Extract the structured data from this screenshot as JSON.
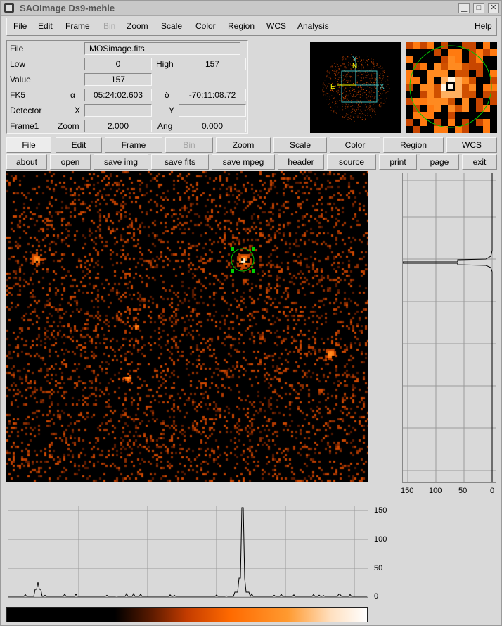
{
  "window": {
    "title": "SAOImage Ds9-mehle",
    "min_glyph": "▁",
    "max_glyph": "□",
    "close_glyph": "✕"
  },
  "menubar": {
    "items": [
      "File",
      "Edit",
      "Frame",
      "Bin",
      "Zoom",
      "Scale",
      "Color",
      "Region",
      "WCS",
      "Analysis"
    ],
    "help": "Help"
  },
  "info": {
    "file_label": "File",
    "file_value": "MOSimage.fits",
    "low_label": "Low",
    "low_value": "0",
    "high_label": "High",
    "high_value": "157",
    "value_label": "Value",
    "value_value": "157",
    "fk5_label": "FK5",
    "alpha_label": "α",
    "alpha_value": "05:24:02.603",
    "delta_label": "δ",
    "delta_value": "-70:11:08.72",
    "detector_label": "Detector",
    "x_label": "X",
    "x_value": "",
    "y_label": "Y",
    "y_value": "",
    "frame_label": "Frame1",
    "zoom_label": "Zoom",
    "zoom_value": "2.000",
    "ang_label": "Ang",
    "ang_value": "0.000"
  },
  "panner": {
    "north_label": "N",
    "east_label": "E",
    "x_axis_label": "X",
    "y_axis_label": "Y"
  },
  "buttonbar_top": [
    "File",
    "Edit",
    "Frame",
    "Bin",
    "Zoom",
    "Scale",
    "Color",
    "Region",
    "WCS"
  ],
  "buttonbar_bottom": [
    "about",
    "open",
    "save img",
    "save fits",
    "save mpeg",
    "header",
    "source",
    "print",
    "page",
    "exit"
  ],
  "vertical_graph": {
    "ticks": [
      "150",
      "100",
      "50",
      "0"
    ]
  },
  "horizontal_graph": {
    "ticks": [
      "150",
      "100",
      "50",
      "0"
    ]
  },
  "colors": {
    "accent": "#ff6a00",
    "region": "#00c800",
    "panner_box": "#40c0c0"
  }
}
